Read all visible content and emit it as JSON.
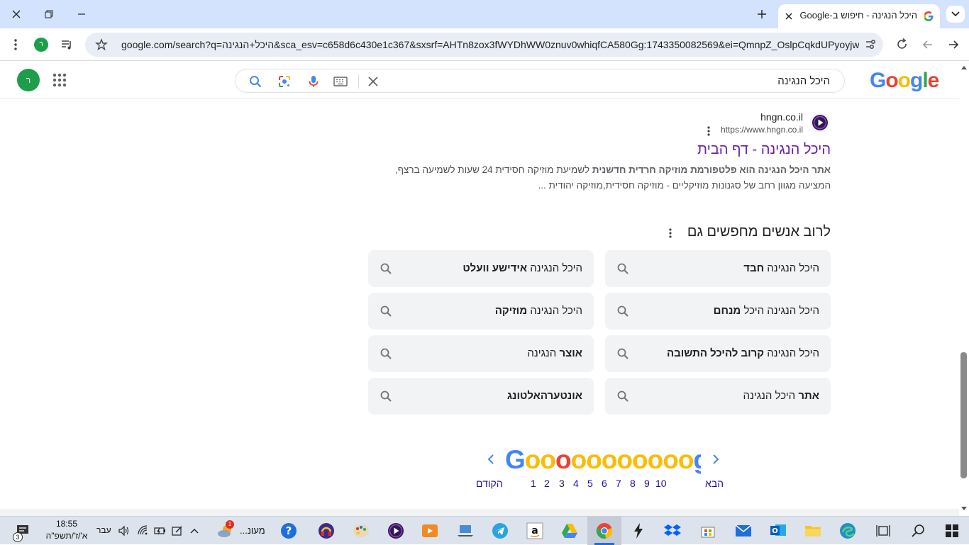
{
  "browser": {
    "tab_title": "היכל הנגינה - חיפוש ב-Google",
    "url": "google.com/search?q=היכל+הנגינה&sca_esv=c658d6c430e1c367&sxsrf=AHTn8zox3fWYDhWW0znuv0whiqfCA580Gg:1743350082569&ei=QmnpZ_OslpCqkdUPyoyjw...",
    "profile_initial": "ר"
  },
  "google": {
    "logo_letters": [
      "G",
      "o",
      "o",
      "g",
      "l",
      "e"
    ],
    "search_value": "היכל הנגינה",
    "account_initial": "ר"
  },
  "result": {
    "site_name": "hngn.co.il",
    "site_url": "https://www.hngn.co.il",
    "title": "היכל הנגינה - דף הבית",
    "snippet_bold": "אתר היכל הנגינה הוא פלטפורמת מוזיקה חרדית חדשנית",
    "snippet_rest": " לשמיעת מוזיקה חסידית 24 שעות לשמיעה ברצף, המציעה מגוון רחב של סגנונות מוזיקליים - מוזיקה חסידית,מוזיקה יהודית ..."
  },
  "people_also_search": {
    "heading": "לרוב אנשים מחפשים גם",
    "items": [
      {
        "plain": "היכל הנגינה ",
        "bold": "חבד",
        "bold_first": false
      },
      {
        "plain": "היכל הנגינה ",
        "bold": "אידישע וועלט",
        "bold_first": false
      },
      {
        "plain": "היכל הנגינה היכל ",
        "bold": "מנחם",
        "bold_first": false
      },
      {
        "plain": "היכל הנגינה ",
        "bold": "מוזיקה",
        "bold_first": false
      },
      {
        "plain": "היכל הנגינה ",
        "bold": "קרוב להיכל התשובה",
        "bold_first": false
      },
      {
        "plain": " הנגינה",
        "bold": "אוצר",
        "bold_first": true
      },
      {
        "plain": " היכל הנגינה",
        "bold": "אתר",
        "bold_first": true
      },
      {
        "plain": "",
        "bold": "אונטערהאלטונג",
        "bold_first": true
      }
    ]
  },
  "pagination": {
    "logo": "Gooooooooooogle",
    "prev_label": "הקודם",
    "next_label": "הבא",
    "pages": [
      "1",
      "2",
      "3",
      "4",
      "5",
      "6",
      "7",
      "8",
      "9",
      "10"
    ],
    "current": "3"
  },
  "taskbar": {
    "time": "18:55",
    "date": "א'/ז'/תשפ\"ה",
    "language": "עבר",
    "weather_label": "מעונ...",
    "notification_count": "3",
    "weather_badge": "1"
  },
  "colors": {
    "link_visited": "#681da8",
    "link": "#1a0dab",
    "chrome_frame": "#d3e3fd",
    "chip_bg": "#f1f3f4"
  }
}
